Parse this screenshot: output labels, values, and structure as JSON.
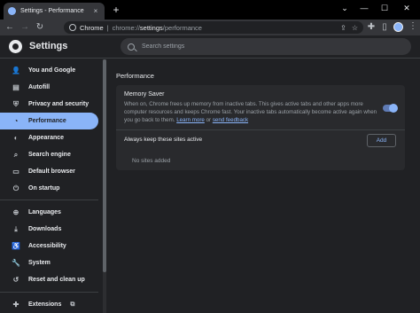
{
  "tab": {
    "title": "Settings - Performance",
    "close": "×",
    "new_tab": "+"
  },
  "window": {
    "dropdown": "⌄",
    "minimize": "—",
    "maximize": "☐",
    "close": "✕"
  },
  "toolbar": {
    "back": "←",
    "forward": "→",
    "reload": "↻",
    "omnibox": {
      "label": "Chrome",
      "sep": "|",
      "scheme": "chrome://",
      "host": "settings",
      "path": "/performance"
    },
    "share": "⇪",
    "bookmark": "☆",
    "extensions": "✚",
    "sidepanel": "▯",
    "menu": "⋮"
  },
  "header": {
    "title": "Settings",
    "search_placeholder": "Search settings"
  },
  "sidebar": {
    "items": [
      {
        "label": "You and Google",
        "icon": "person-icon",
        "glyph": "👤"
      },
      {
        "label": "Autofill",
        "icon": "clipboard-icon",
        "glyph": "▤"
      },
      {
        "label": "Privacy and security",
        "icon": "shield-icon",
        "glyph": "⛨"
      },
      {
        "label": "Performance",
        "icon": "speedometer-icon",
        "glyph": "◔"
      },
      {
        "label": "Appearance",
        "icon": "palette-icon",
        "glyph": "◐"
      },
      {
        "label": "Search engine",
        "icon": "search-icon",
        "glyph": "⌕"
      },
      {
        "label": "Default browser",
        "icon": "browser-icon",
        "glyph": "▭"
      },
      {
        "label": "On startup",
        "icon": "power-icon",
        "glyph": "⏻"
      },
      {
        "label": "Languages",
        "icon": "globe-icon",
        "glyph": "⊕"
      },
      {
        "label": "Downloads",
        "icon": "download-icon",
        "glyph": "⤓"
      },
      {
        "label": "Accessibility",
        "icon": "accessibility-icon",
        "glyph": "♿"
      },
      {
        "label": "System",
        "icon": "wrench-icon",
        "glyph": "🔧"
      },
      {
        "label": "Reset and clean up",
        "icon": "reset-icon",
        "glyph": "↺"
      },
      {
        "label": "Extensions",
        "icon": "puzzle-icon",
        "glyph": "✚",
        "external": "⧉"
      }
    ]
  },
  "main": {
    "section_title": "Performance",
    "memory_saver": {
      "title": "Memory Saver",
      "description": "When on, Chrome frees up memory from inactive tabs. This gives active tabs and other apps more computer resources and keeps Chrome fast. Your inactive tabs automatically become active again when you go back to them.",
      "learn_more": "Learn more",
      "or": "or",
      "send_feedback": "send feedback",
      "enabled": true
    },
    "keep_active": {
      "title": "Always keep these sites active",
      "add_label": "Add",
      "empty_text": "No sites added"
    }
  },
  "colors": {
    "accent": "#8ab4f8",
    "background": "#202124",
    "card": "#292a2d"
  }
}
